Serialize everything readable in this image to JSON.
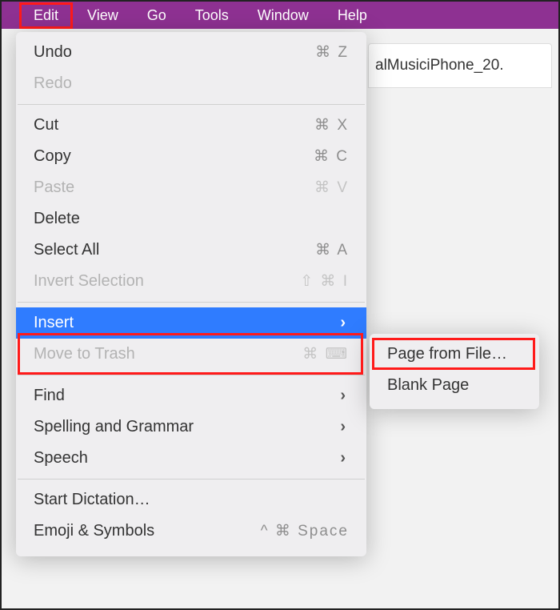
{
  "menubar": {
    "items": [
      "Edit",
      "View",
      "Go",
      "Tools",
      "Window",
      "Help"
    ],
    "active_index": 0
  },
  "background_title_fragment": "alMusiciPhone_20.",
  "dropdown": {
    "sections": [
      [
        {
          "label": "Undo",
          "shortcut": "⌘ Z",
          "enabled": true
        },
        {
          "label": "Redo",
          "shortcut": "",
          "enabled": false
        }
      ],
      [
        {
          "label": "Cut",
          "shortcut": "⌘ X",
          "enabled": true
        },
        {
          "label": "Copy",
          "shortcut": "⌘ C",
          "enabled": true
        },
        {
          "label": "Paste",
          "shortcut": "⌘ V",
          "enabled": false
        },
        {
          "label": "Delete",
          "shortcut": "",
          "enabled": true
        },
        {
          "label": "Select All",
          "shortcut": "⌘ A",
          "enabled": true
        },
        {
          "label": "Invert Selection",
          "shortcut": "⇧ ⌘  I",
          "enabled": false
        }
      ],
      [
        {
          "label": "Insert",
          "shortcut": "",
          "enabled": true,
          "submenu": true,
          "highlighted": true
        },
        {
          "label": "Move to Trash",
          "shortcut": "⌘ ⌨",
          "enabled": false
        }
      ],
      [
        {
          "label": "Find",
          "shortcut": "",
          "enabled": true,
          "submenu": true
        },
        {
          "label": "Spelling and Grammar",
          "shortcut": "",
          "enabled": true,
          "submenu": true
        },
        {
          "label": "Speech",
          "shortcut": "",
          "enabled": true,
          "submenu": true
        }
      ],
      [
        {
          "label": "Start Dictation…",
          "shortcut": "",
          "enabled": true
        },
        {
          "label": "Emoji & Symbols",
          "shortcut": "^ ⌘ Space",
          "enabled": true
        }
      ]
    ]
  },
  "submenu": {
    "items": [
      {
        "label": "Page from File…",
        "highlighted": true
      },
      {
        "label": "Blank Page",
        "highlighted": false
      }
    ]
  }
}
